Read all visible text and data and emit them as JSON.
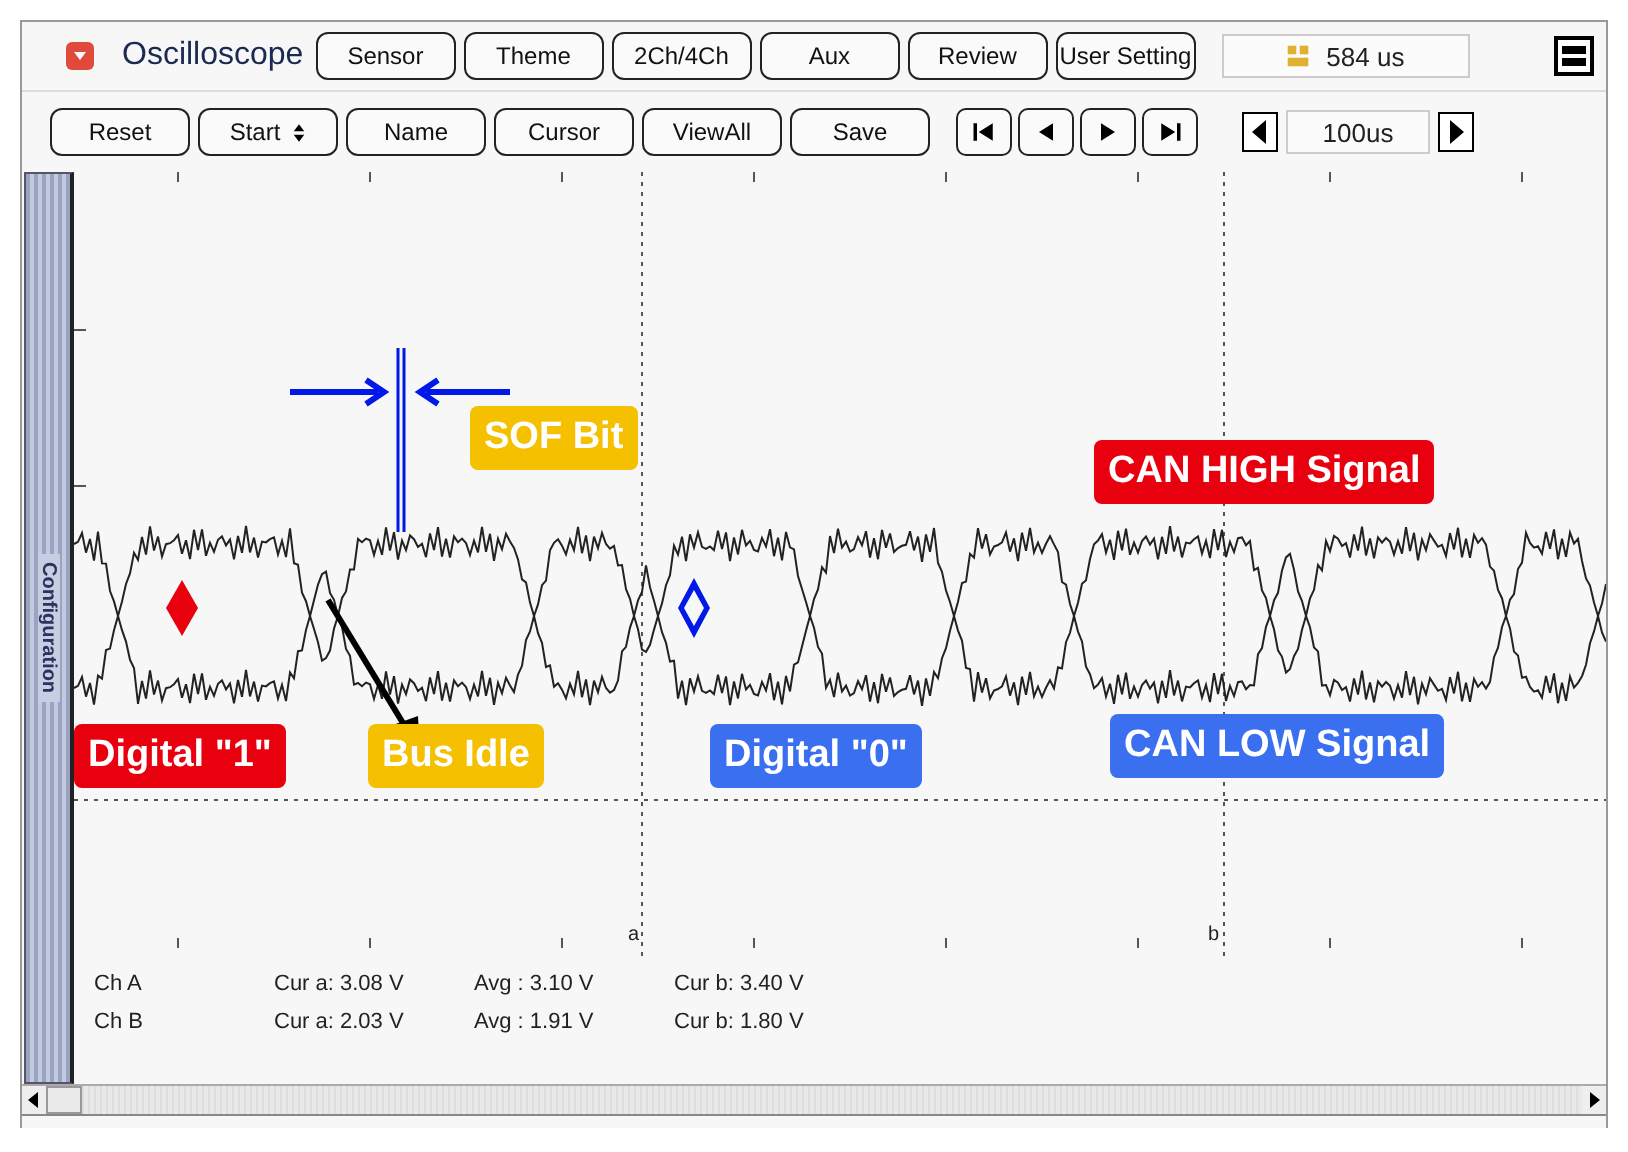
{
  "app": {
    "title": "Oscilloscope"
  },
  "top_buttons": [
    "Sensor",
    "Theme",
    "2Ch/4Ch",
    "Aux",
    "Review",
    "User Setting"
  ],
  "time_display": "584 us",
  "controls": [
    {
      "label": "Reset",
      "kind": "button"
    },
    {
      "label": "Start",
      "kind": "spin"
    },
    {
      "label": "Name",
      "kind": "button"
    },
    {
      "label": "Cursor",
      "kind": "button"
    },
    {
      "label": "ViewAll",
      "kind": "button"
    },
    {
      "label": "Save",
      "kind": "button"
    }
  ],
  "timebase": "100us",
  "side_tab": "Configuration",
  "cursors": [
    "a",
    "b"
  ],
  "annotations": [
    {
      "text": "SOF Bit",
      "color": "#f5c000"
    },
    {
      "text": "CAN HIGH Signal",
      "color": "#e8000f"
    },
    {
      "text": "Digital \"1\"",
      "color": "#e8000f"
    },
    {
      "text": "Bus Idle",
      "color": "#f5c000"
    },
    {
      "text": "Digital \"0\"",
      "color": "#3a6fef"
    },
    {
      "text": "CAN LOW Signal",
      "color": "#3a6fef"
    }
  ],
  "readouts": [
    {
      "channel": "Ch A",
      "cur_a": "Cur a: 3.08 V",
      "avg": "Avg : 3.10 V",
      "cur_b": "Cur b: 3.40 V"
    },
    {
      "channel": "Ch B",
      "cur_a": "Cur a: 2.03 V",
      "avg": "Avg : 1.91 V",
      "cur_b": "Cur b: 1.80 V"
    }
  ]
}
